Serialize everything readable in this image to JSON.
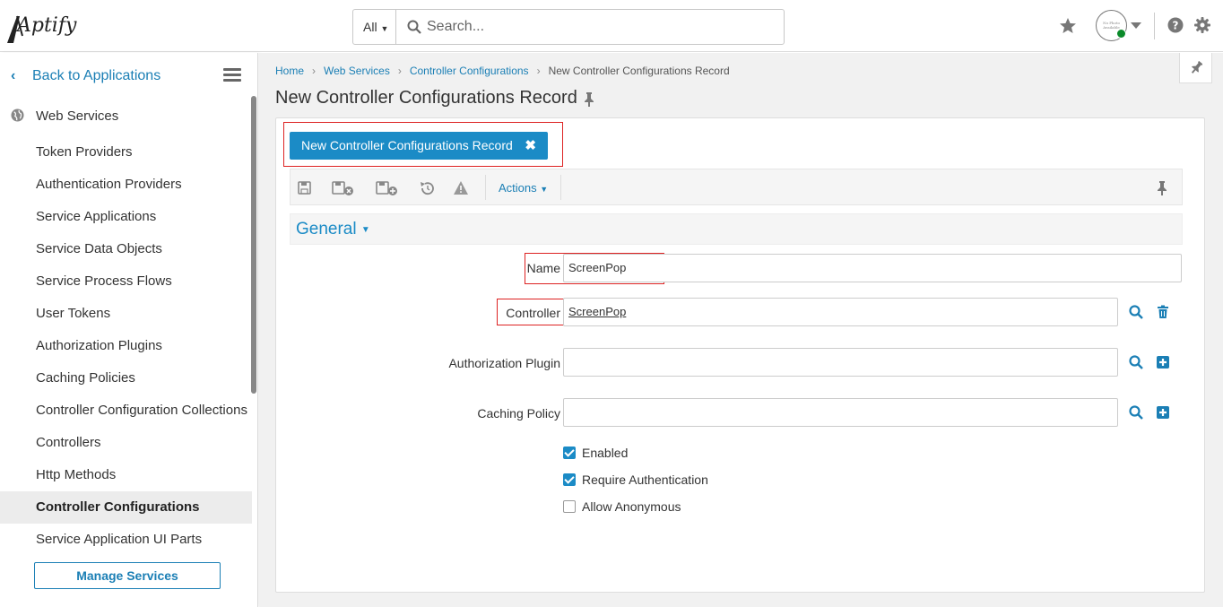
{
  "header": {
    "logo_text": "Aptify",
    "search_scope": "All",
    "search_placeholder": "Search...",
    "avatar_text": "No Photo Available"
  },
  "sidebar": {
    "back_label": "Back to Applications",
    "module_label": "Web Services",
    "items": [
      {
        "label": "Token Providers"
      },
      {
        "label": "Authentication Providers"
      },
      {
        "label": "Service Applications"
      },
      {
        "label": "Service Data Objects"
      },
      {
        "label": "Service Process Flows"
      },
      {
        "label": "User Tokens"
      },
      {
        "label": "Authorization Plugins"
      },
      {
        "label": "Caching Policies"
      },
      {
        "label": "Controller Configuration Collections"
      },
      {
        "label": "Controllers"
      },
      {
        "label": "Http Methods"
      },
      {
        "label": "Controller Configurations",
        "active": true
      },
      {
        "label": "Service Application UI Parts"
      }
    ],
    "manage_label": "Manage Services"
  },
  "breadcrumb": {
    "items": [
      "Home",
      "Web Services",
      "Controller Configurations"
    ],
    "current": "New Controller Configurations Record"
  },
  "page": {
    "title": "New Controller Configurations Record",
    "tab_label": "New Controller Configurations Record",
    "actions_label": "Actions",
    "section_label": "General"
  },
  "form": {
    "name_label": "Name",
    "name_value": "ScreenPop",
    "controller_label": "Controller",
    "controller_value": "ScreenPop",
    "auth_plugin_label": "Authorization Plugin",
    "auth_plugin_value": "",
    "caching_label": "Caching Policy",
    "caching_value": "",
    "enabled_label": "Enabled",
    "enabled": true,
    "require_auth_label": "Require Authentication",
    "require_auth": true,
    "allow_anon_label": "Allow Anonymous",
    "allow_anon": false
  },
  "colors": {
    "accent": "#1b8bc6",
    "link": "#1b7fb5",
    "highlight": "#dd2222"
  }
}
